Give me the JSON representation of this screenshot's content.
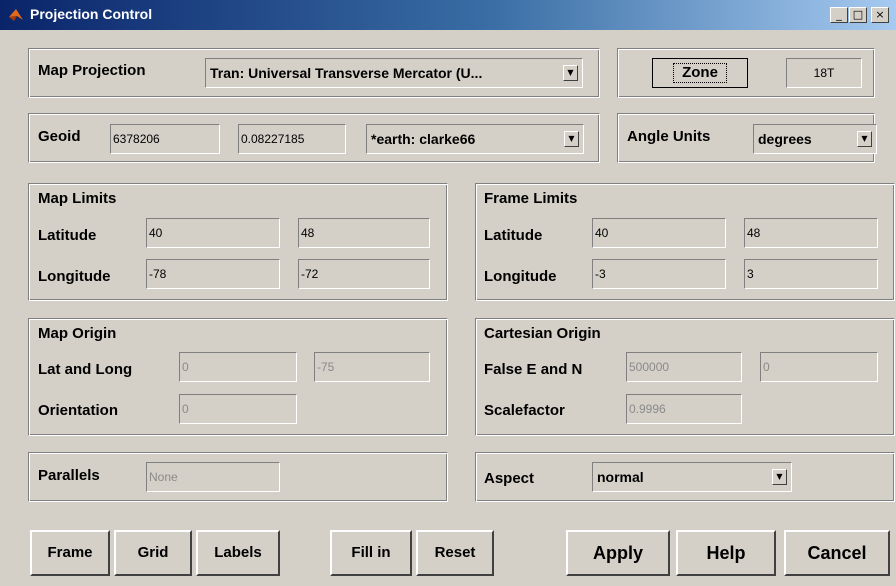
{
  "window": {
    "title": "Projection Control",
    "controls": {
      "minimize": "_",
      "maximize": "□",
      "close": "×"
    }
  },
  "projection": {
    "label": "Map Projection",
    "selected": "Tran: Universal Transverse Mercator (U...",
    "zone_button": "Zone",
    "zone_value": "18T"
  },
  "geoid": {
    "label": "Geoid",
    "semimajor": "6378206",
    "eccentricity": "0.08227185",
    "ellipsoid": "*earth: clarke66"
  },
  "angle_units": {
    "label": "Angle Units",
    "selected": "degrees"
  },
  "map_limits": {
    "title": "Map Limits",
    "latitude_label": "Latitude",
    "lat_min": "40",
    "lat_max": "48",
    "longitude_label": "Longitude",
    "lon_min": "-78",
    "lon_max": "-72"
  },
  "frame_limits": {
    "title": "Frame Limits",
    "latitude_label": "Latitude",
    "lat_min": "40",
    "lat_max": "48",
    "longitude_label": "Longitude",
    "lon_min": "-3",
    "lon_max": "3"
  },
  "map_origin": {
    "title": "Map Origin",
    "latlong_label": "Lat and Long",
    "lat": "0",
    "long": "-75",
    "orientation_label": "Orientation",
    "orientation": "0"
  },
  "cartesian_origin": {
    "title": "Cartesian Origin",
    "false_label": "False E and N",
    "false_easting": "500000",
    "false_northing": "0",
    "scale_label": "Scalefactor",
    "scalefactor": "0.9996"
  },
  "parallels": {
    "label": "Parallels",
    "value": "None"
  },
  "aspect": {
    "label": "Aspect",
    "selected": "normal"
  },
  "buttons": {
    "frame": "Frame",
    "grid": "Grid",
    "labels": "Labels",
    "fill_in": "Fill in",
    "reset": "Reset",
    "apply": "Apply",
    "help": "Help",
    "cancel": "Cancel"
  },
  "icons": {
    "app": "matlab-logo-icon",
    "dropdown": "dropdown-arrow-icon"
  },
  "colors": {
    "face": "#d4d0c8",
    "title_start": "#0a246a",
    "title_end": "#a6caf0",
    "disabled_text": "#8a8a8a"
  }
}
